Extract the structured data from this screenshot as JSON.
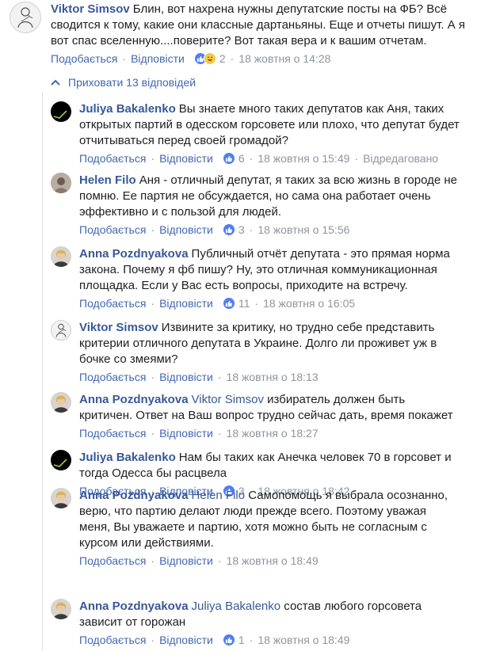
{
  "common": {
    "like_label": "Подобається",
    "reply_label": "Відповісти",
    "separator": "·"
  },
  "main_comment": {
    "author": "Viktor Simsov",
    "text": "Блин, вот нахрена нужны депутатские посты на ФБ? Всё сводится к тому, какие они классные дартаньяны. Еще и отчеты пишут. А я вот спас вселенную....поверите? Вот такая вера и к вашим отчетам.",
    "reactions": [
      "like-icon",
      "haha-icon"
    ],
    "reaction_count": "2",
    "time": "18 жовтня о 14:28"
  },
  "hide_replies_label": "Приховати 13 відповідей",
  "replies": [
    {
      "author": "Juliya Bakalenko",
      "avatar": "juliya",
      "mention": "",
      "text": "Вы знаете много таких депутатов как Аня, таких открытых партий в одесском горсовете или плохо, что депутат будет отчитываться перед своей громадой?",
      "reaction_count": "6",
      "time": "18 жовтня о 15:49",
      "edited": "Відредаговано"
    },
    {
      "author": "Helen Filo",
      "avatar": "helen",
      "mention": "",
      "text": "Аня - отличный депутат, я таких за всю жизнь в городе не помню. Ее партия не обсуждается, но сама она работает очень эффективно и с пользой для людей.",
      "reaction_count": "3",
      "time": "18 жовтня о 15:56",
      "edited": ""
    },
    {
      "author": "Anna Pozdnyakova",
      "avatar": "anna",
      "mention": "",
      "text": "Публичный отчёт депутата - это прямая норма закона. Почему я фб пишу? Ну, это отличная коммуникационная площадка. Если у Вас есть вопросы, приходите на встречу.",
      "reaction_count": "11",
      "time": "18 жовтня о 16:05",
      "edited": ""
    },
    {
      "author": "Viktor Simsov",
      "avatar": "viktor",
      "mention": "",
      "text": "Извините за критику, но трудно себе представить критерии отличного депутата в Украине. Долго ли проживет уж в бочке со змеями?",
      "reaction_count": "",
      "time": "18 жовтня о 18:13",
      "edited": ""
    },
    {
      "author": "Anna Pozdnyakova",
      "avatar": "anna",
      "mention": "Viktor Simsov",
      "text": "избиратель должен быть критичен. Ответ на Ваш вопрос трудно сейчас дать, время покажет",
      "reaction_count": "",
      "time": "18 жовтня о 18:27",
      "edited": ""
    },
    {
      "author": "Juliya Bakalenko",
      "avatar": "juliya",
      "mention": "",
      "text": "Нам бы таких как Анечка человек 70 в горсовет и тогда Одесса бы расцвела",
      "reaction_count": "3",
      "time": "18 жовтня о 18:42",
      "edited": ""
    },
    {
      "author": "Anna Pozdnyakova",
      "avatar": "anna",
      "mention": "Helen Filo",
      "text": "Самопомощь я выбрала осознанно, верю, что партию делают люди прежде всего. Поэтому уважая меня, Вы уважаете и партию, хотя можно быть не согласным с курсом или действиями.",
      "reaction_count": "",
      "time": "18 жовтня о 18:49",
      "edited": ""
    },
    {
      "author": "Anna Pozdnyakova",
      "avatar": "anna",
      "mention": "Juliya Bakalenko",
      "text": "состав любого горсовета зависит от горожан",
      "reaction_count": "1",
      "time": "18 жовтня о 18:49",
      "edited": ""
    }
  ]
}
